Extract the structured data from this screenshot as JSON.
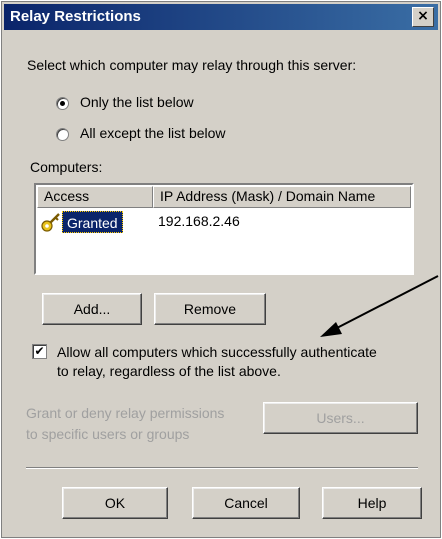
{
  "window": {
    "title": "Relay Restrictions",
    "close_glyph": "×"
  },
  "instruction": "Select which computer may relay through this server:",
  "radios": {
    "only_list": {
      "label": "Only the list below",
      "selected": true
    },
    "all_except": {
      "label": "All except the list below",
      "selected": false
    }
  },
  "computers": {
    "label": "Computers:",
    "columns": [
      "Access",
      "IP Address (Mask) / Domain Name"
    ],
    "rows": [
      {
        "access": "Granted",
        "address": "192.168.2.46",
        "icon": "key-icon"
      }
    ]
  },
  "buttons": {
    "add": "Add...",
    "remove": "Remove",
    "users": "Users...",
    "ok": "OK",
    "cancel": "Cancel",
    "help": "Help"
  },
  "allow_authenticated": {
    "checked": true,
    "check_glyph": "✔",
    "line1": "Allow all computers which successfully authenticate",
    "line2": "to relay, regardless of the list above."
  },
  "grant_deny": {
    "line1": "Grant or deny relay permissions",
    "line2": "to specific users or groups"
  },
  "colors": {
    "titlebar": "#0a246a",
    "dialog_bg": "#d4d0c8",
    "selection": "#0a246a",
    "disabled_text": "#a0a0a0"
  }
}
